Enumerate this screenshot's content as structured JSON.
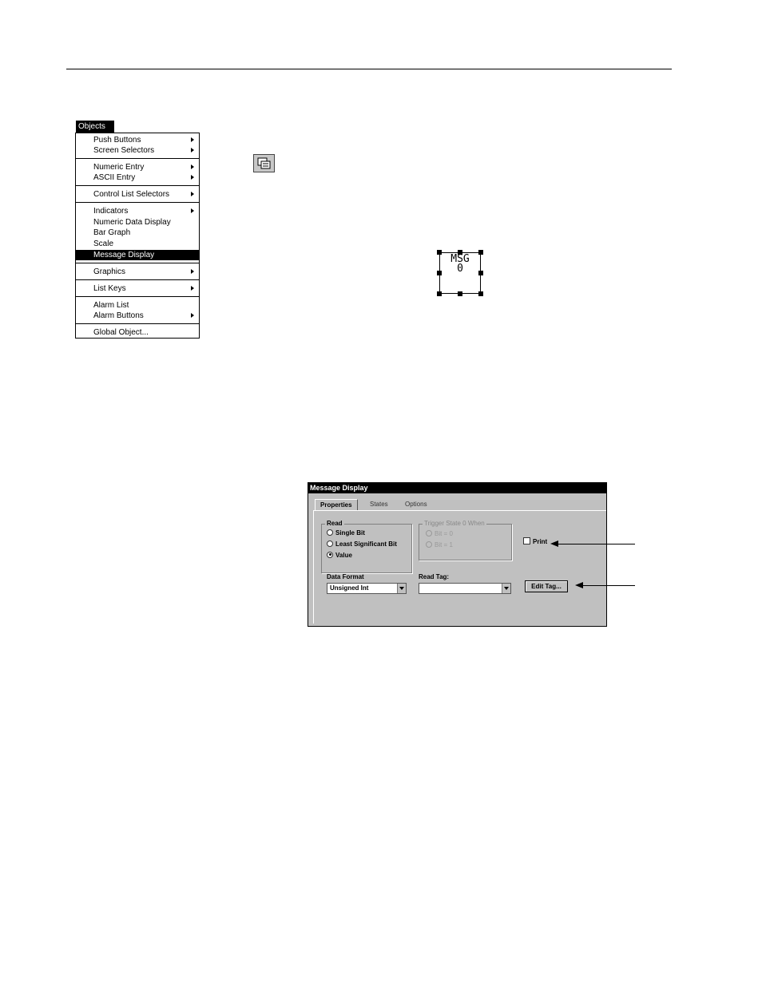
{
  "menu": {
    "title": "Objects",
    "items": [
      {
        "label": "Push Buttons",
        "submenu": true
      },
      {
        "label": "Screen Selectors",
        "submenu": true
      },
      {
        "label": "Numeric Entry",
        "submenu": true
      },
      {
        "label": "ASCII Entry",
        "submenu": true
      },
      {
        "label": "Control List Selectors",
        "submenu": true
      },
      {
        "label": "Indicators",
        "submenu": true
      },
      {
        "label": "Numeric Data Display",
        "submenu": false
      },
      {
        "label": "Bar Graph",
        "submenu": false
      },
      {
        "label": "Scale",
        "submenu": false
      },
      {
        "label": "Message Display",
        "submenu": false,
        "selected": true
      },
      {
        "label": "Graphics",
        "submenu": true
      },
      {
        "label": "List Keys",
        "submenu": true
      },
      {
        "label": "Alarm List",
        "submenu": false
      },
      {
        "label": "Alarm Buttons",
        "submenu": true
      },
      {
        "label": "Global Object...",
        "submenu": false
      }
    ]
  },
  "tool": {
    "icon": "message-display-tool-icon"
  },
  "object": {
    "line1": "MSG",
    "line2": "0"
  },
  "dialog": {
    "title": "Message Display",
    "tabs": [
      "Properties",
      "States",
      "Options"
    ],
    "read_group": {
      "label": "Read",
      "options": [
        "Single Bit",
        "Least Significant Bit",
        "Value"
      ],
      "selected": "Value"
    },
    "trigger_group": {
      "label": "Trigger State 0 When",
      "options": [
        "Bit = 0",
        "Bit = 1"
      ]
    },
    "print_label": "Print",
    "data_format_label": "Data Format",
    "data_format_value": "Unsigned Int",
    "read_tag_label": "Read Tag:",
    "read_tag_value": "",
    "edit_tag_label": "Edit Tag..."
  }
}
